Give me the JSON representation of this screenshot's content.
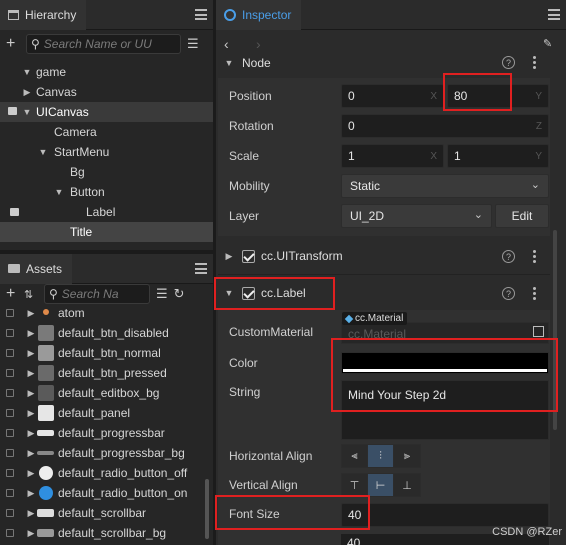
{
  "hierarchy": {
    "tab_label": "Hierarchy",
    "search_placeholder": "Search Name or UU",
    "nodes": [
      {
        "label": "game"
      },
      {
        "label": "Canvas"
      },
      {
        "label": "UICanvas"
      },
      {
        "label": "Camera"
      },
      {
        "label": "StartMenu"
      },
      {
        "label": "Bg"
      },
      {
        "label": "Button"
      },
      {
        "label": "Label"
      },
      {
        "label": "Title"
      }
    ]
  },
  "assets": {
    "tab_label": "Assets",
    "search_placeholder": "Search Na",
    "items": [
      {
        "label": "atom"
      },
      {
        "label": "default_btn_disabled"
      },
      {
        "label": "default_btn_normal"
      },
      {
        "label": "default_btn_pressed"
      },
      {
        "label": "default_editbox_bg"
      },
      {
        "label": "default_panel"
      },
      {
        "label": "default_progressbar"
      },
      {
        "label": "default_progressbar_bg"
      },
      {
        "label": "default_radio_button_off"
      },
      {
        "label": "default_radio_button_on"
      },
      {
        "label": "default_scrollbar"
      },
      {
        "label": "default_scrollbar_bg"
      }
    ]
  },
  "inspector": {
    "tab_label": "Inspector",
    "node_section": "Node",
    "position_label": "Position",
    "position_x": "0",
    "position_y": "80",
    "rotation_label": "Rotation",
    "rotation_z": "0",
    "scale_label": "Scale",
    "scale_x": "1",
    "scale_y": "1",
    "mobility_label": "Mobility",
    "mobility_value": "Static",
    "layer_label": "Layer",
    "layer_value": "UI_2D",
    "edit_label": "Edit",
    "uitransform_section": "cc.UITransform",
    "label_section": "cc.Label",
    "custom_material_label": "CustomMaterial",
    "material_tag": "cc.Material",
    "material_placeholder": "cc.Material",
    "color_label": "Color",
    "string_label": "String",
    "string_value": "Mind Your Step 2d",
    "h_align_label": "Horizontal Align",
    "v_align_label": "Vertical Align",
    "font_size_label": "Font Size",
    "font_size_value": "40",
    "line_height_value": "40"
  },
  "axes": {
    "x": "X",
    "y": "Y",
    "z": "Z"
  },
  "watermark": "CSDN @RZer"
}
